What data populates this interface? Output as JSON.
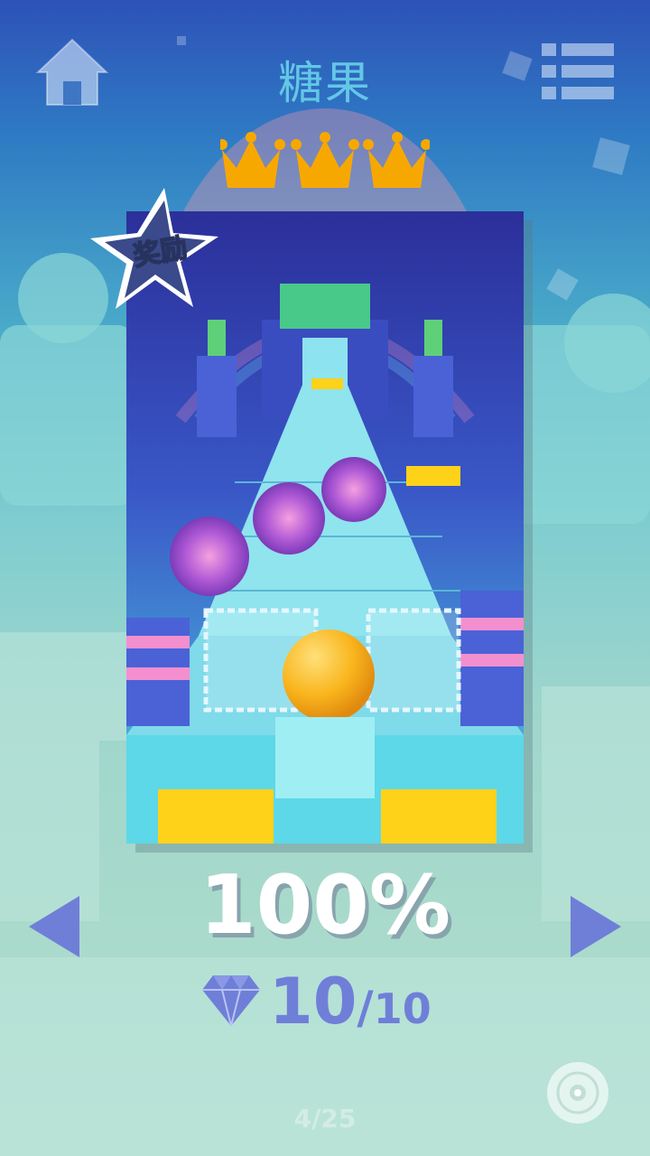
{
  "level": {
    "title": "糖果",
    "stars_earned": 3,
    "stars_total": 3,
    "badge_label": "奖励",
    "completion": "100%",
    "gems_collected": "10",
    "gems_separator": "/",
    "gems_total": "10",
    "page_indicator": "4/25"
  },
  "icons": {
    "home": "home-icon",
    "menu": "list-menu-icon",
    "crown": "crown-icon",
    "gem": "diamond-icon",
    "prev": "left-triangle-icon",
    "next": "right-triangle-icon",
    "music": "disc-icon"
  },
  "colors": {
    "title": "#63c7e6",
    "crown": "#f7a800",
    "arrow": "#6f7fd8",
    "gem": "#6f7fd8",
    "badge_text": "#ffc43b",
    "ball": "#f9b51c"
  }
}
